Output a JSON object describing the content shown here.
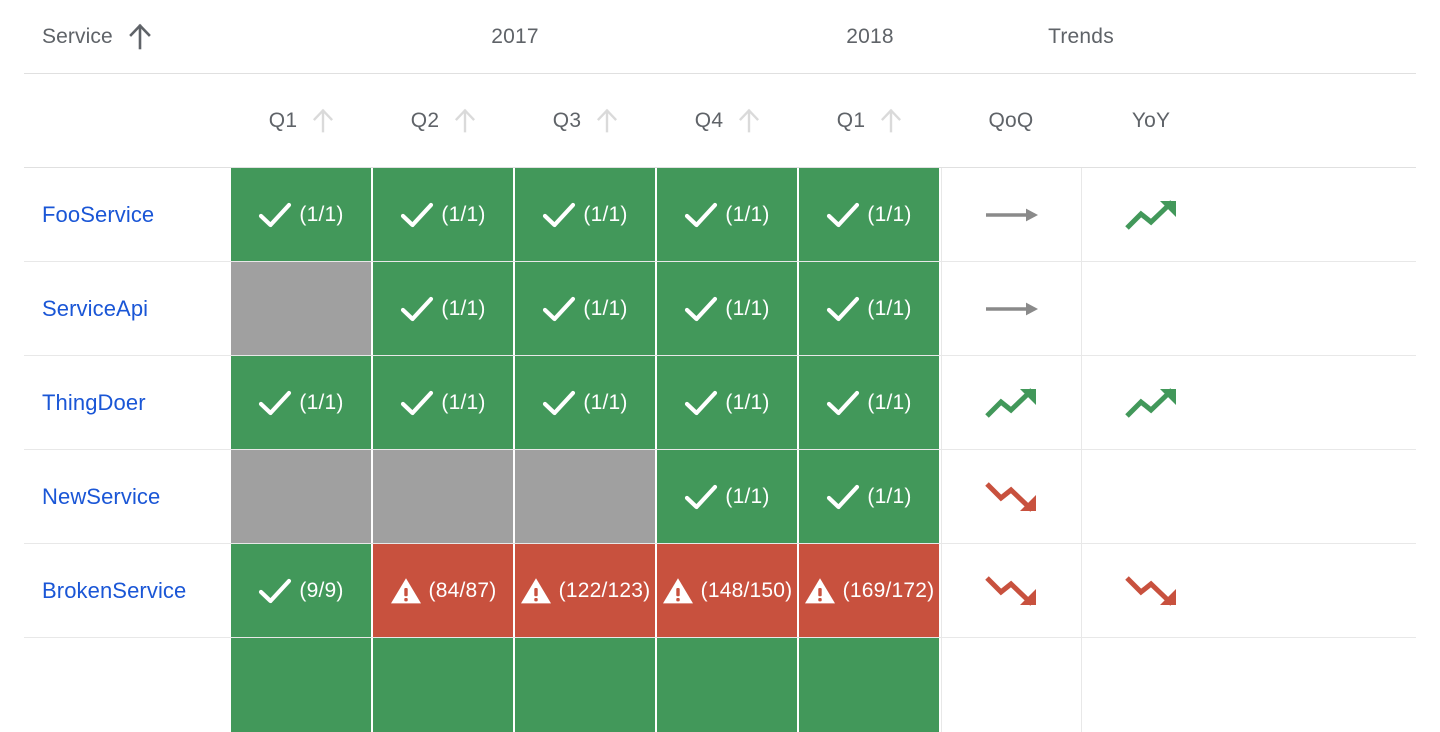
{
  "header": {
    "service_column_label": "Service",
    "service_sort_icon": "sort-arrow-up-icon",
    "service_sort_state": "active",
    "year_groups": [
      {
        "label": "2017",
        "span": 4
      },
      {
        "label": "2018",
        "span": 1
      }
    ],
    "trends_group_label": "Trends",
    "quarters": [
      {
        "label": "Q1",
        "sort_icon": "sort-arrow-up-icon",
        "sort_state": "inactive"
      },
      {
        "label": "Q2",
        "sort_icon": "sort-arrow-up-icon",
        "sort_state": "inactive"
      },
      {
        "label": "Q3",
        "sort_icon": "sort-arrow-up-icon",
        "sort_state": "inactive"
      },
      {
        "label": "Q4",
        "sort_icon": "sort-arrow-up-icon",
        "sort_state": "inactive"
      },
      {
        "label": "Q1",
        "sort_icon": "sort-arrow-up-icon",
        "sort_state": "inactive"
      }
    ],
    "trend_columns": [
      {
        "label": "QoQ"
      },
      {
        "label": "YoY"
      }
    ]
  },
  "colors": {
    "pass": "#42985a",
    "fail": "#c8513e",
    "no_data": "#a0a0a0",
    "link": "#1a56d6",
    "header_text": "#5f6368",
    "trend_up": "#42985a",
    "trend_down": "#c8513e",
    "trend_flat": "#8a8a8a",
    "grid_line": "#e8e8e8"
  },
  "rows": [
    {
      "service": "FooService",
      "cells": [
        {
          "status": "pass",
          "icon": "check-icon",
          "value": "(1/1)"
        },
        {
          "status": "pass",
          "icon": "check-icon",
          "value": "(1/1)"
        },
        {
          "status": "pass",
          "icon": "check-icon",
          "value": "(1/1)"
        },
        {
          "status": "pass",
          "icon": "check-icon",
          "value": "(1/1)"
        },
        {
          "status": "pass",
          "icon": "check-icon",
          "value": "(1/1)"
        }
      ],
      "trends": [
        {
          "column": "QoQ",
          "direction": "flat",
          "icon": "trend-flat-arrow-icon"
        },
        {
          "column": "YoY",
          "direction": "up",
          "icon": "trend-up-arrow-icon"
        }
      ]
    },
    {
      "service": "ServiceApi",
      "cells": [
        {
          "status": "none",
          "icon": "",
          "value": ""
        },
        {
          "status": "pass",
          "icon": "check-icon",
          "value": "(1/1)"
        },
        {
          "status": "pass",
          "icon": "check-icon",
          "value": "(1/1)"
        },
        {
          "status": "pass",
          "icon": "check-icon",
          "value": "(1/1)"
        },
        {
          "status": "pass",
          "icon": "check-icon",
          "value": "(1/1)"
        }
      ],
      "trends": [
        {
          "column": "QoQ",
          "direction": "flat",
          "icon": "trend-flat-arrow-icon"
        },
        {
          "column": "YoY",
          "direction": "none",
          "icon": ""
        }
      ]
    },
    {
      "service": "ThingDoer",
      "cells": [
        {
          "status": "pass",
          "icon": "check-icon",
          "value": "(1/1)"
        },
        {
          "status": "pass",
          "icon": "check-icon",
          "value": "(1/1)"
        },
        {
          "status": "pass",
          "icon": "check-icon",
          "value": "(1/1)"
        },
        {
          "status": "pass",
          "icon": "check-icon",
          "value": "(1/1)"
        },
        {
          "status": "pass",
          "icon": "check-icon",
          "value": "(1/1)"
        }
      ],
      "trends": [
        {
          "column": "QoQ",
          "direction": "up",
          "icon": "trend-up-arrow-icon"
        },
        {
          "column": "YoY",
          "direction": "up",
          "icon": "trend-up-arrow-icon"
        }
      ]
    },
    {
      "service": "NewService",
      "cells": [
        {
          "status": "none",
          "icon": "",
          "value": ""
        },
        {
          "status": "none",
          "icon": "",
          "value": ""
        },
        {
          "status": "none",
          "icon": "",
          "value": ""
        },
        {
          "status": "pass",
          "icon": "check-icon",
          "value": "(1/1)"
        },
        {
          "status": "pass",
          "icon": "check-icon",
          "value": "(1/1)"
        }
      ],
      "trends": [
        {
          "column": "QoQ",
          "direction": "down",
          "icon": "trend-down-arrow-icon"
        },
        {
          "column": "YoY",
          "direction": "none",
          "icon": ""
        }
      ]
    },
    {
      "service": "BrokenService",
      "cells": [
        {
          "status": "pass",
          "icon": "check-icon",
          "value": "(9/9)"
        },
        {
          "status": "fail",
          "icon": "warning-icon",
          "value": "(84/87)"
        },
        {
          "status": "fail",
          "icon": "warning-icon",
          "value": "(122/123)"
        },
        {
          "status": "fail",
          "icon": "warning-icon",
          "value": "(148/150)"
        },
        {
          "status": "fail",
          "icon": "warning-icon",
          "value": "(169/172)"
        }
      ],
      "trends": [
        {
          "column": "QoQ",
          "direction": "down",
          "icon": "trend-down-arrow-icon"
        },
        {
          "column": "YoY",
          "direction": "down",
          "icon": "trend-down-arrow-icon"
        }
      ]
    },
    {
      "service": "",
      "partial": true,
      "cells": [
        {
          "status": "pass",
          "icon": "",
          "value": ""
        },
        {
          "status": "pass",
          "icon": "",
          "value": ""
        },
        {
          "status": "pass",
          "icon": "",
          "value": ""
        },
        {
          "status": "pass",
          "icon": "",
          "value": ""
        },
        {
          "status": "pass",
          "icon": "",
          "value": ""
        }
      ],
      "trends": [
        {
          "column": "QoQ",
          "direction": "none",
          "icon": ""
        },
        {
          "column": "YoY",
          "direction": "none",
          "icon": ""
        }
      ]
    }
  ]
}
